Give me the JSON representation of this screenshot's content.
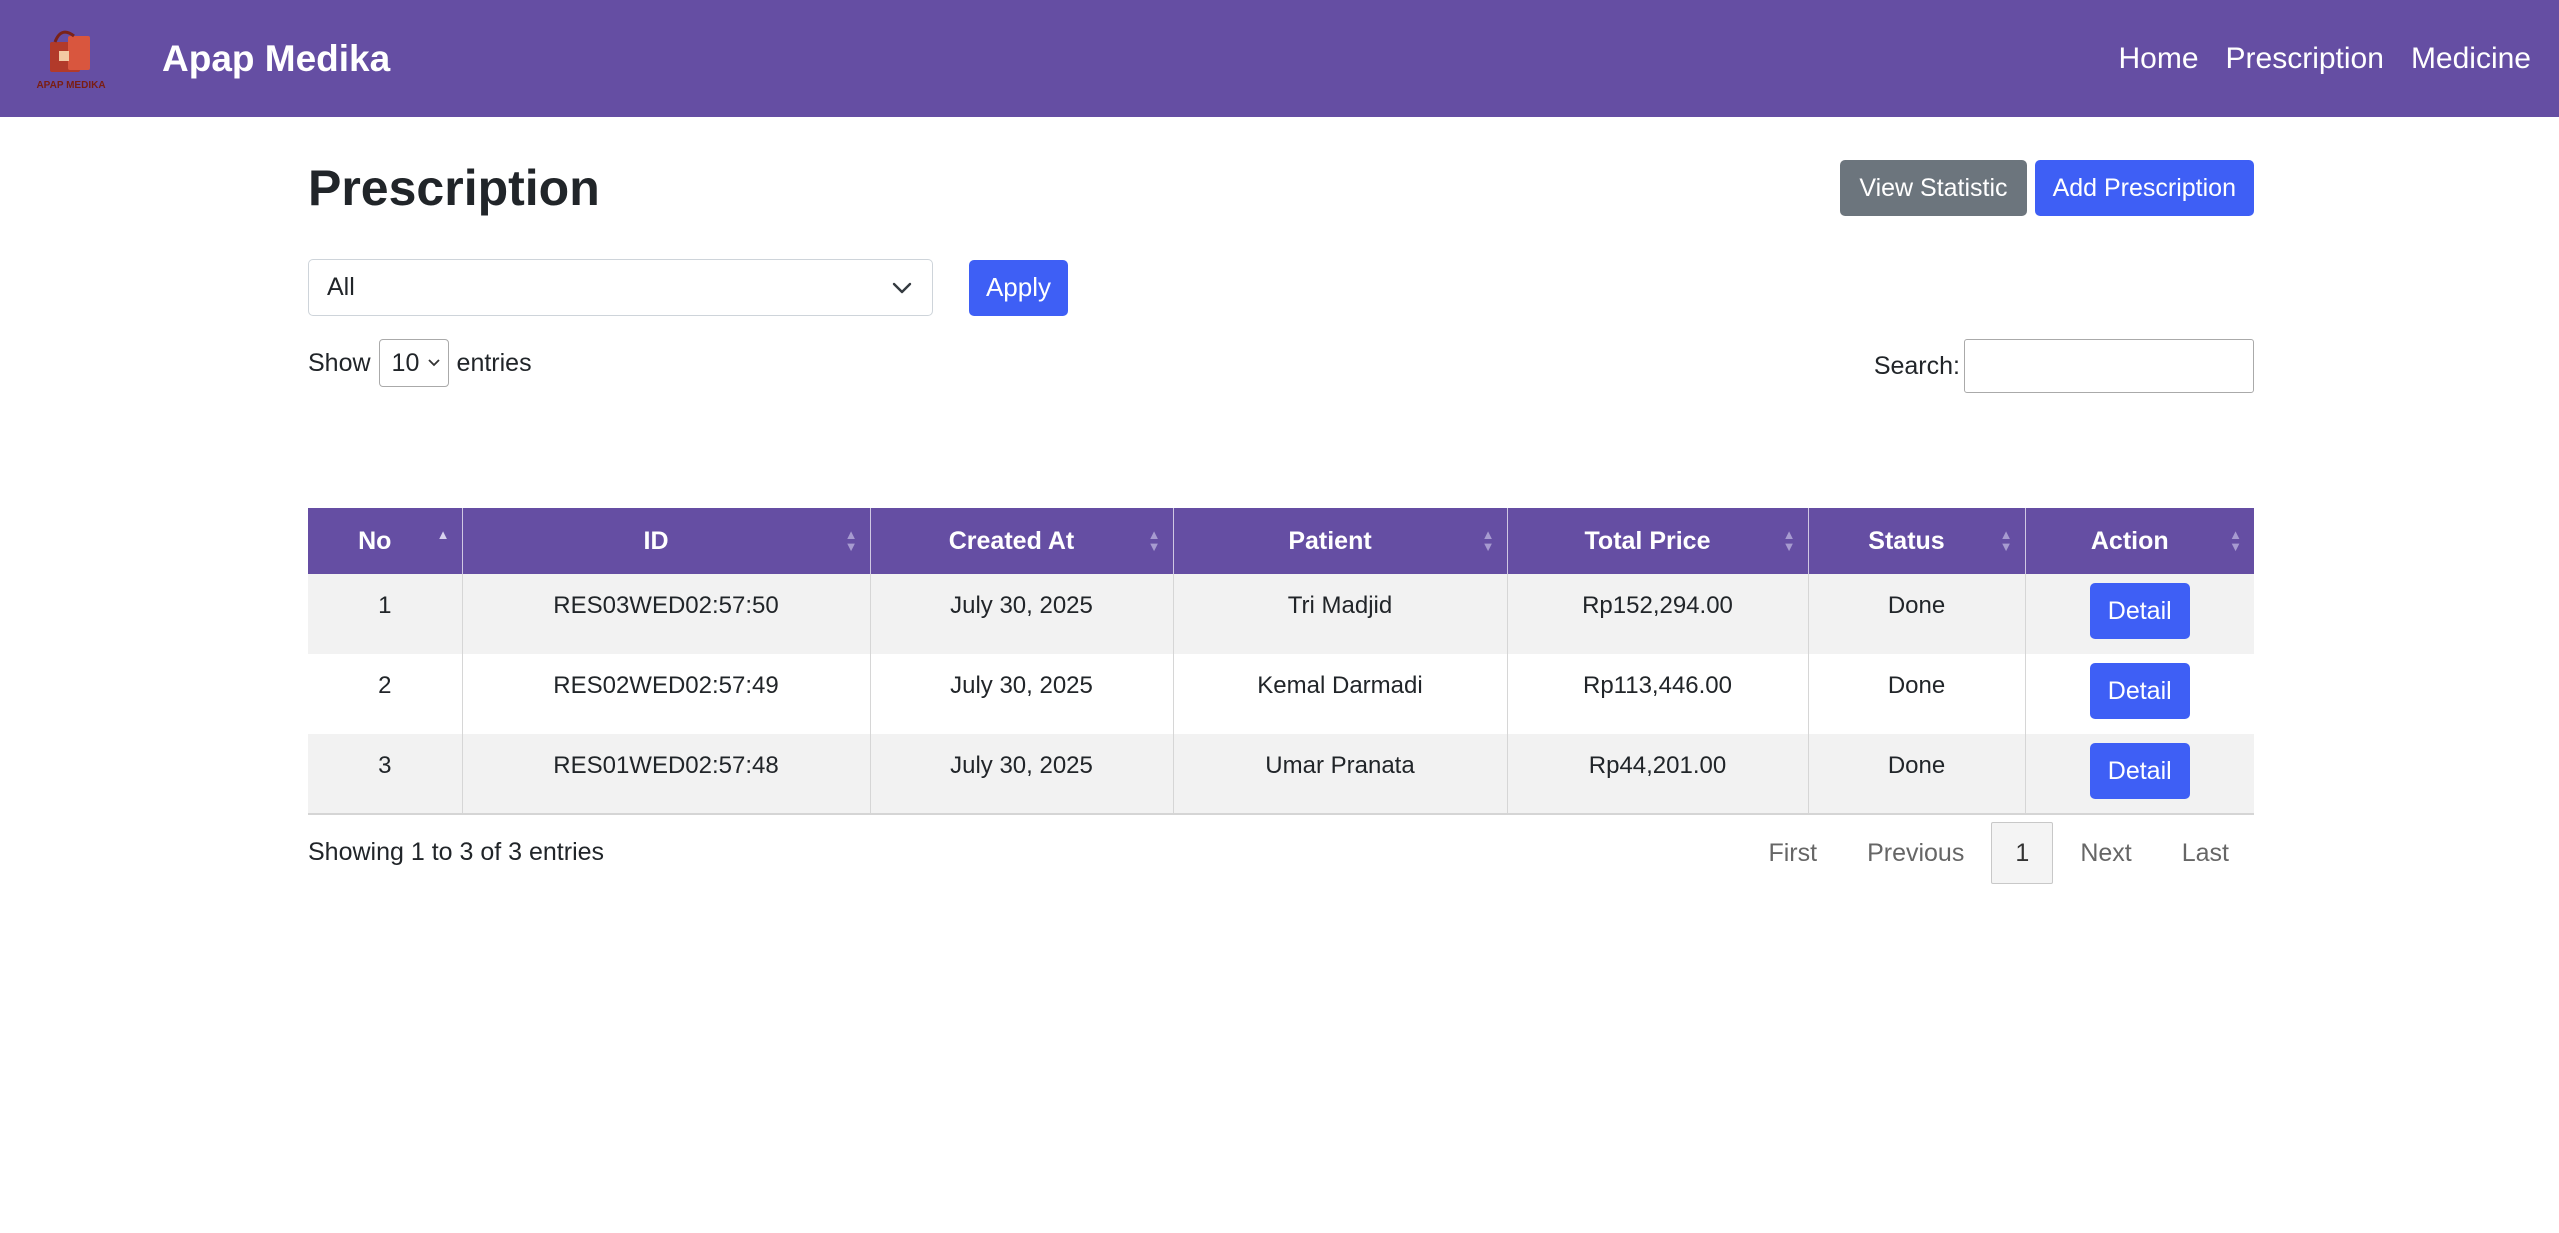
{
  "brand": {
    "name": "Apap Medika",
    "logo_text": "APAP MEDIKA"
  },
  "nav": {
    "items": [
      "Home",
      "Prescription",
      "Medicine"
    ]
  },
  "page": {
    "title": "Prescription",
    "view_statistic_label": "View Statistic",
    "add_prescription_label": "Add Prescription"
  },
  "filter": {
    "selected": "All",
    "apply_label": "Apply"
  },
  "length": {
    "show_label": "Show",
    "value": "10",
    "entries_label": "entries"
  },
  "search": {
    "label": "Search:",
    "value": ""
  },
  "table": {
    "columns": [
      "No",
      "ID",
      "Created At",
      "Patient",
      "Total Price",
      "Status",
      "Action"
    ],
    "rows": [
      {
        "no": "1",
        "id": "RES03WED02:57:50",
        "created_at": "July 30, 2025",
        "patient": "Tri Madjid",
        "total_price": "Rp152,294.00",
        "status": "Done",
        "action": "Detail"
      },
      {
        "no": "2",
        "id": "RES02WED02:57:49",
        "created_at": "July 30, 2025",
        "patient": "Kemal Darmadi",
        "total_price": "Rp113,446.00",
        "status": "Done",
        "action": "Detail"
      },
      {
        "no": "3",
        "id": "RES01WED02:57:48",
        "created_at": "July 30, 2025",
        "patient": "Umar Pranata",
        "total_price": "Rp44,201.00",
        "status": "Done",
        "action": "Detail"
      }
    ]
  },
  "info": "Showing 1 to 3 of 3 entries",
  "pagination": {
    "first": "First",
    "previous": "Previous",
    "current": "1",
    "next": "Next",
    "last": "Last"
  },
  "colors": {
    "navbar": "#654ea3",
    "primary": "#3e5ff5",
    "secondary": "#6c757d",
    "logo_red": "#b23a2a"
  }
}
